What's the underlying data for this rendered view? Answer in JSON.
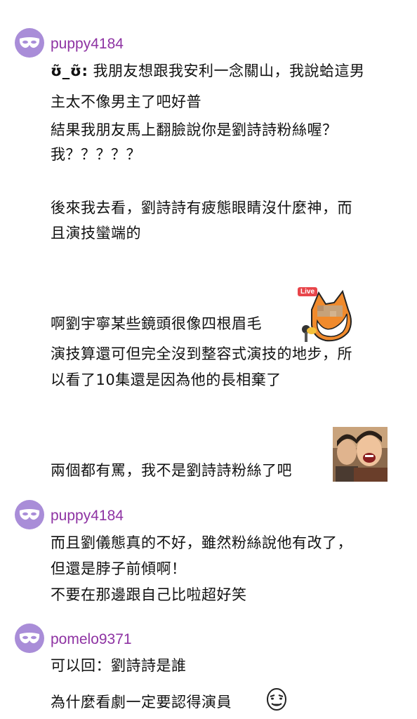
{
  "comments": [
    {
      "username": "puppy4184",
      "prefix": "ʊ̃_ʊ̃:",
      "lines": [
        "我朋友想跟我安利一念關山，我說蛤這男",
        "主太不像男主了吧好普",
        "結果我朋友馬上翻臉說你是劉詩詩粉絲喔？",
        "我？？？？？",
        "後來我去看，劉詩詩有疲態眼睛沒什麼神，而",
        "且演技蠻端的",
        "啊劉宇寧某些鏡頭很像四根眉毛",
        "演技算還可但完全沒到整容式演技的地步，所",
        "以看了10集還是因為他的長相棄了",
        "兩個都有罵，我不是劉詩詩粉絲了吧"
      ],
      "sticker_fox_badge": "Live"
    },
    {
      "username": "puppy4184",
      "lines": [
        "而且劉儀態真的不好，雖然粉絲說他有改了，",
        "但還是脖子前傾啊！",
        "不要在那邊跟自己比啦超好笑"
      ]
    },
    {
      "username": "pomelo9371",
      "lines": [
        "可以回：劉詩詩是誰",
        "為什麼看劇一定要認得演員"
      ]
    }
  ],
  "colors": {
    "avatar_bg": "#a98dd8",
    "username": "#8e33a3",
    "text": "#111111",
    "live_badge": "#e8454a"
  },
  "icons": {
    "avatar": "mask-icon",
    "sticker_1": "fox-microphone-sticker",
    "sticker_2": "laughing-people-photo",
    "sticker_3": "smirk-face-emoji"
  }
}
